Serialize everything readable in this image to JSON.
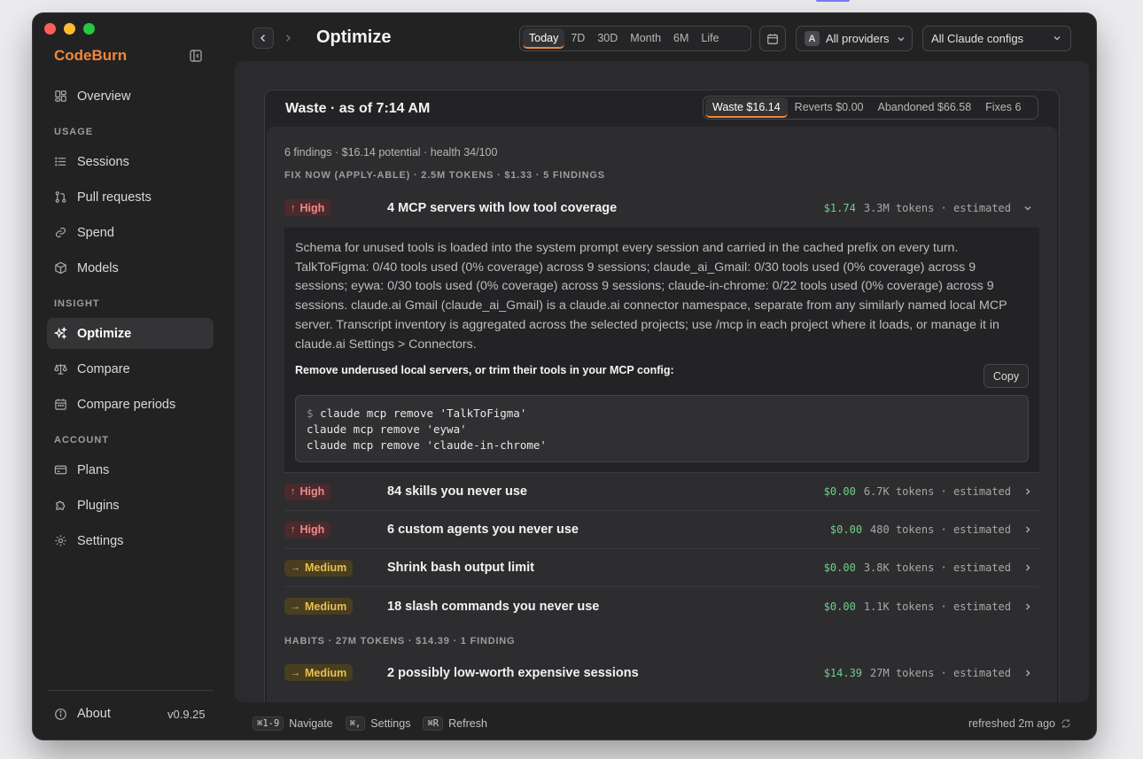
{
  "brand": "CodeBurn",
  "sidebar": {
    "overview": "Overview",
    "sections": {
      "usage": "USAGE",
      "insight": "INSIGHT",
      "account": "ACCOUNT"
    },
    "usage_items": [
      "Sessions",
      "Pull requests",
      "Spend",
      "Models"
    ],
    "insight_items": [
      "Optimize",
      "Compare",
      "Compare periods"
    ],
    "account_items": [
      "Plans",
      "Plugins",
      "Settings"
    ],
    "about": "About",
    "version": "v0.9.25"
  },
  "header": {
    "title": "Optimize",
    "ranges": [
      "Today",
      "7D",
      "30D",
      "Month",
      "6M",
      "Life"
    ],
    "active_range": "Today",
    "provider_badge": "A",
    "provider": "All providers",
    "config": "All Claude configs"
  },
  "card": {
    "title": "Waste · as of 7:14 AM",
    "tabs": [
      "Waste $16.14",
      "Reverts $0.00",
      "Abandoned $66.58",
      "Fixes 6"
    ],
    "active_tab": "Waste $16.14",
    "summary": "6 findings · $16.14 potential · health 34/100",
    "groups": [
      {
        "header": "FIX NOW (APPLY-ABLE) · 2.5M TOKENS · $1.33 · 5 FINDINGS"
      },
      {
        "header": "HABITS · 27M TOKENS · $14.39 · 1 FINDING"
      }
    ],
    "findings": [
      {
        "severity": "High",
        "title": "4 MCP servers with low tool coverage",
        "amount": "$1.74",
        "meta": "3.3M tokens · estimated",
        "expanded": true
      },
      {
        "severity": "High",
        "title": "84 skills you never use",
        "amount": "$0.00",
        "meta": "6.7K tokens · estimated"
      },
      {
        "severity": "High",
        "title": "6 custom agents you never use",
        "amount": "$0.00",
        "meta": "480 tokens · estimated"
      },
      {
        "severity": "Medium",
        "title": "Shrink bash output limit",
        "amount": "$0.00",
        "meta": "3.8K tokens · estimated"
      },
      {
        "severity": "Medium",
        "title": "18 slash commands you never use",
        "amount": "$0.00",
        "meta": "1.1K tokens · estimated"
      },
      {
        "severity": "Medium",
        "title": "2 possibly low-worth expensive sessions",
        "amount": "$14.39",
        "meta": "27M tokens · estimated"
      }
    ],
    "detail": {
      "text": "Schema for unused tools is loaded into the system prompt every session and carried in the cached prefix on every turn. TalkToFigma: 0/40 tools used (0% coverage) across 9 sessions; claude_ai_Gmail: 0/30 tools used (0% coverage) across 9 sessions; eywa: 0/30 tools used (0% coverage) across 9 sessions; claude-in-chrome: 0/22 tools used (0% coverage) across 9 sessions. claude.ai Gmail (claude_ai_Gmail) is a claude.ai connector namespace, separate from any similarly named local MCP server. Transcript inventory is aggregated across the selected projects; use /mcp in each project where it loads, or manage it in claude.ai Settings > Connectors.",
      "subheading": "Remove underused local servers, or trim their tools in your MCP config:",
      "copy_label": "Copy",
      "prompt": "$",
      "commands": [
        "claude mcp remove 'TalkToFigma'",
        "claude mcp remove 'eywa'",
        "claude mcp remove 'claude-in-chrome'"
      ]
    }
  },
  "footer": {
    "shortcuts": [
      {
        "key": "⌘1-9",
        "label": "Navigate"
      },
      {
        "key": "⌘,",
        "label": "Settings"
      },
      {
        "key": "⌘R",
        "label": "Refresh"
      }
    ],
    "refreshed": "refreshed 2m ago"
  },
  "colors": {
    "accent": "#f0873a",
    "amount_green": "#6fcf8a",
    "high": "#f08a8a",
    "medium": "#e7c04e"
  }
}
